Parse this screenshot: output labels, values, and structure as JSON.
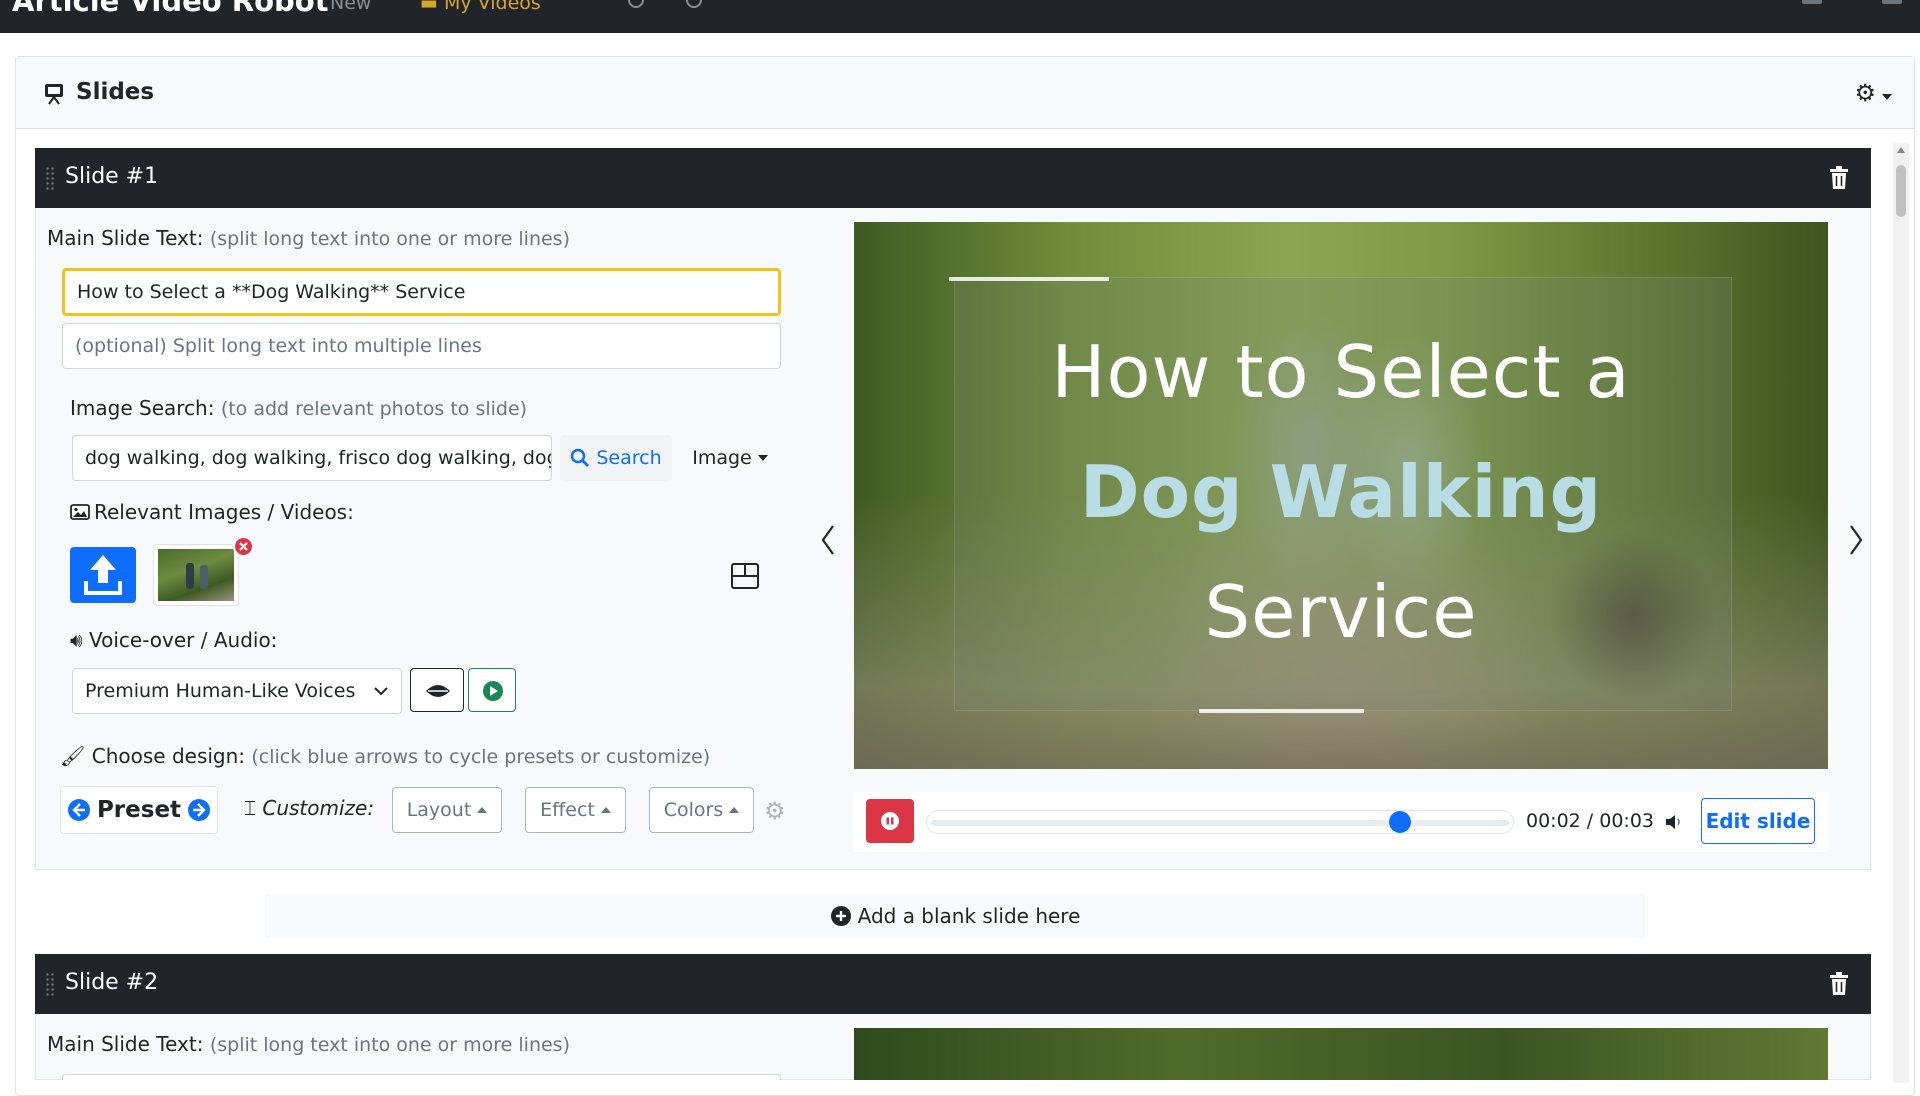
{
  "navbar": {
    "brand": "Article Video Robot",
    "links": [
      {
        "label": "New"
      },
      {
        "label": "My Videos"
      }
    ]
  },
  "slides_panel": {
    "title": "Slides",
    "icon": "slides-icon",
    "settings_icon": "gear-icon"
  },
  "slides": [
    {
      "title": "Slide #1",
      "main_text_label": "Main Slide Text:",
      "main_text_hint": "(split long text into one or more lines)",
      "main_text_value": "How to Select a **Dog Walking** Service",
      "split_placeholder": "(optional) Split long text into multiple lines",
      "image_search_label": "Image Search:",
      "image_search_hint": "(to add relevant photos to slide)",
      "image_search_value": "dog walking, dog walking, frisco dog walking, dog",
      "search_button": "Search",
      "media_type_select": "Image",
      "relevant_media_label": "Relevant Images / Videos:",
      "voice_label": "Voice-over / Audio:",
      "voice_select": "Premium Human-Like Voices",
      "design_label": "Choose design:",
      "design_hint": "(click blue arrows to cycle presets or customize)",
      "preset_label": "Preset",
      "customize_label": "Customize:",
      "layout_button": "Layout",
      "effect_button": "Effect",
      "colors_button": "Colors",
      "preview": {
        "line1": "How to Select a",
        "line2": "Dog Walking",
        "line3": "Service",
        "highlight_color": "#b9dde4",
        "text_color": "#ffffff"
      },
      "player": {
        "time": "00:02 / 00:03",
        "progress": 0.82,
        "edit_button": "Edit slide"
      }
    },
    {
      "title": "Slide #2",
      "main_text_label": "Main Slide Text:",
      "main_text_hint": "(split long text into one or more lines)"
    }
  ],
  "add_blank_slide": "Add a blank slide here",
  "colors": {
    "primary": "#0d6efd",
    "danger": "#dc3545",
    "success": "#198754",
    "dark": "#212529",
    "focus": "#f0c419"
  }
}
